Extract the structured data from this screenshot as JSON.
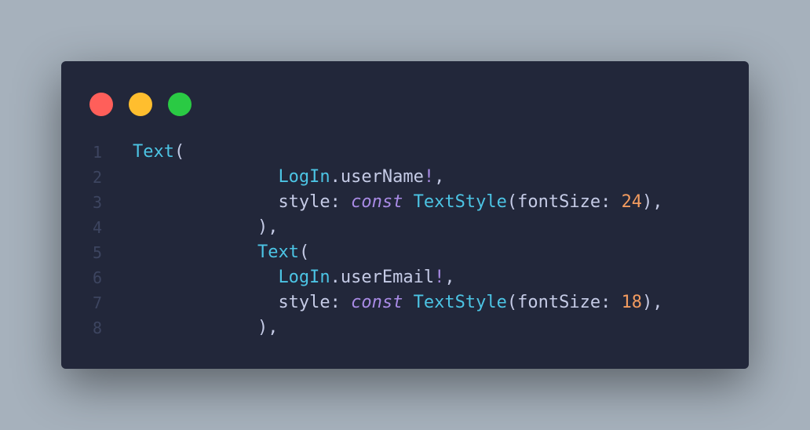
{
  "colors": {
    "background": "#a6b1bc",
    "window": "#22273a",
    "dot_close": "#ff5f5a",
    "dot_minimize": "#ffbe2e",
    "dot_maximize": "#2aca44",
    "class": "#4cc4e4",
    "keyword": "#a98be6",
    "number": "#f29b5f",
    "text": "#c5cbe6",
    "line_number": "#3d4560"
  },
  "window_controls": [
    "close-dot",
    "minimize-dot",
    "maximize-dot"
  ],
  "code": {
    "lines": [
      {
        "number": "1",
        "indent": "",
        "tokens": [
          {
            "type": "cls",
            "text": "Text"
          },
          {
            "type": "id",
            "text": "("
          }
        ]
      },
      {
        "number": "2",
        "indent": "              ",
        "tokens": [
          {
            "type": "cls",
            "text": "LogIn"
          },
          {
            "type": "id",
            "text": ".userName"
          },
          {
            "type": "op",
            "text": "!"
          },
          {
            "type": "id",
            "text": ","
          }
        ]
      },
      {
        "number": "3",
        "indent": "              ",
        "tokens": [
          {
            "type": "id",
            "text": "style: "
          },
          {
            "type": "kw",
            "text": "const"
          },
          {
            "type": "id",
            "text": " "
          },
          {
            "type": "cls",
            "text": "TextStyle"
          },
          {
            "type": "id",
            "text": "(fontSize: "
          },
          {
            "type": "num",
            "text": "24"
          },
          {
            "type": "id",
            "text": "),"
          }
        ]
      },
      {
        "number": "4",
        "indent": "            ",
        "tokens": [
          {
            "type": "id",
            "text": "),"
          }
        ]
      },
      {
        "number": "5",
        "indent": "            ",
        "tokens": [
          {
            "type": "cls",
            "text": "Text"
          },
          {
            "type": "id",
            "text": "("
          }
        ]
      },
      {
        "number": "6",
        "indent": "              ",
        "tokens": [
          {
            "type": "cls",
            "text": "LogIn"
          },
          {
            "type": "id",
            "text": ".userEmail"
          },
          {
            "type": "op",
            "text": "!"
          },
          {
            "type": "id",
            "text": ","
          }
        ]
      },
      {
        "number": "7",
        "indent": "              ",
        "tokens": [
          {
            "type": "id",
            "text": "style: "
          },
          {
            "type": "kw",
            "text": "const"
          },
          {
            "type": "id",
            "text": " "
          },
          {
            "type": "cls",
            "text": "TextStyle"
          },
          {
            "type": "id",
            "text": "(fontSize: "
          },
          {
            "type": "num",
            "text": "18"
          },
          {
            "type": "id",
            "text": "),"
          }
        ]
      },
      {
        "number": "8",
        "indent": "            ",
        "tokens": [
          {
            "type": "id",
            "text": "),"
          }
        ]
      }
    ]
  }
}
